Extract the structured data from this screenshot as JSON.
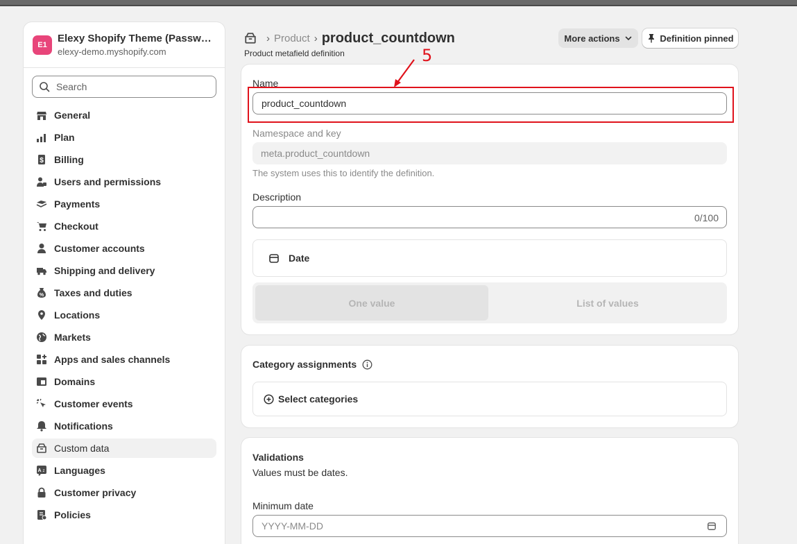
{
  "sidebar": {
    "store": {
      "initials": "E1",
      "name": "Elexy Shopify Theme (Password protected)",
      "domain": "elexy-demo.myshopify.com",
      "avatar_color": "#e8457a"
    },
    "search": {
      "placeholder": "Search"
    },
    "items": [
      {
        "label": "General",
        "icon": "store-icon"
      },
      {
        "label": "Plan",
        "icon": "plan-icon"
      },
      {
        "label": "Billing",
        "icon": "billing-icon"
      },
      {
        "label": "Users and permissions",
        "icon": "users-icon"
      },
      {
        "label": "Payments",
        "icon": "payments-icon"
      },
      {
        "label": "Checkout",
        "icon": "cart-icon"
      },
      {
        "label": "Customer accounts",
        "icon": "person-icon"
      },
      {
        "label": "Shipping and delivery",
        "icon": "truck-icon"
      },
      {
        "label": "Taxes and duties",
        "icon": "tax-icon"
      },
      {
        "label": "Locations",
        "icon": "location-icon"
      },
      {
        "label": "Markets",
        "icon": "globe-icon"
      },
      {
        "label": "Apps and sales channels",
        "icon": "apps-icon"
      },
      {
        "label": "Domains",
        "icon": "domain-icon"
      },
      {
        "label": "Customer events",
        "icon": "cursor-icon"
      },
      {
        "label": "Notifications",
        "icon": "bell-icon"
      },
      {
        "label": "Custom data",
        "icon": "custom-data-icon",
        "active": true
      },
      {
        "label": "Languages",
        "icon": "language-icon"
      },
      {
        "label": "Customer privacy",
        "icon": "lock-icon"
      },
      {
        "label": "Policies",
        "icon": "policy-icon"
      }
    ]
  },
  "header": {
    "breadcrumb_parent": "Product",
    "title": "product_countdown",
    "subtitle": "Product metafield definition",
    "more_actions_label": "More actions",
    "pinned_label": "Definition pinned"
  },
  "definition": {
    "name_label": "Name",
    "name_value": "product_countdown",
    "namespace_label": "Namespace and key",
    "namespace_value": "meta.product_countdown",
    "namespace_help": "The system uses this to identify the definition.",
    "description_label": "Description",
    "description_counter": "0/100",
    "type_label": "Date",
    "one_value_label": "One value",
    "list_values_label": "List of values"
  },
  "categories": {
    "title": "Category assignments",
    "select_label": "Select categories"
  },
  "validations": {
    "title": "Validations",
    "subtitle": "Values must be dates.",
    "min_date_label": "Minimum date",
    "min_date_placeholder": "YYYY-MM-DD"
  },
  "annotation": {
    "number": "5",
    "color": "#e0121b"
  }
}
